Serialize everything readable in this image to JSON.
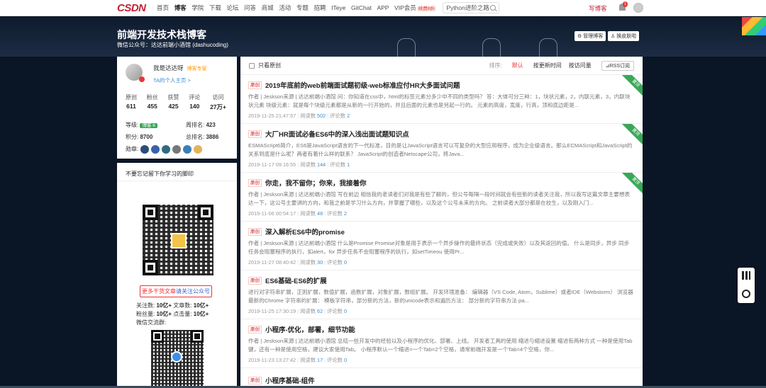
{
  "topbar": {
    "logo": "CSDN",
    "nav": [
      "首页",
      "博客",
      "学院",
      "下载",
      "论坛",
      "问答",
      "商城",
      "活动",
      "专题",
      "招聘",
      "ITeye",
      "GitChat",
      "APP"
    ],
    "vip": "VIP会员",
    "vip_badge": "续费8折",
    "search_value": "Python进阶之路",
    "write": "写博客",
    "bell_count": "1"
  },
  "banner": {
    "title": "前端开发技术栈博客",
    "subtitle": "微信公众号：达达前端小酒馆 (dashucoding)",
    "manage_btn": "管理博客",
    "skin_btn": "换皮肤啦"
  },
  "profile": {
    "name": "我是达达呀",
    "badge": "博客专家",
    "home_link": "TA的个人主页 >",
    "stats": [
      {
        "label": "原创",
        "value": "611"
      },
      {
        "label": "粉丝",
        "value": "455"
      },
      {
        "label": "获赞",
        "value": "425"
      },
      {
        "label": "评论",
        "value": "140"
      },
      {
        "label": "访问",
        "value": "27万+"
      }
    ],
    "level_label": "等级:",
    "level_badge": "博客 6",
    "week_rank_label": "周排名:",
    "week_rank": "423",
    "points_label": "积分:",
    "points": "8700",
    "total_rank_label": "总排名:",
    "total_rank": "3886",
    "medals_label": "勋章:"
  },
  "promo": {
    "heading": "不要忘记留下你学习的脚印",
    "follow_prefix": "更多干货文章",
    "follow_highlight": "请关注公众号",
    "l1": "关注数:",
    "v1": "10亿+",
    "l2": "文章数:",
    "v2": "10亿+",
    "l3": "粉丝量:",
    "v3": "10亿+",
    "l4": "点击量:",
    "v4": "10亿+",
    "group": "微信交流群:"
  },
  "toolbar": {
    "only_original": "只看原创",
    "sort_label": "排序:",
    "sort_default": "默认",
    "sort_time": "按更新时间",
    "sort_views": "按访问量",
    "rss": "RSS订阅"
  },
  "articles": [
    {
      "tag": "原创",
      "title": "2019年底前的web前端面试题初级-web标准应付HR大多面试问题",
      "summary": "作者 | Jeskson来源 | 达达前端小酒馆 问：你知道在css中，html的标签元素分多少中不同的类型吗？ 答：大体可分三种：1，块状元素，2，内联元素，3，内联块状元素 块级元素：就是每个块级元素都是从新的一行开始的，并且后面的元素也是另起一行的。 元素的高度，宽度，行高，顶和底边距是...",
      "date": "2019-11-25 21:47:57",
      "reads_label": "阅读数",
      "reads": "502",
      "comments_label": "评论数",
      "comments": "2",
      "pinned": "置顶"
    },
    {
      "tag": "原创",
      "title": "大厂HR面试必备ES6中的深入浅出面试题知识点",
      "summary": "ESMAScript6简介，ES6是JavaScript语言的下一代标准，目的是让JavaScript语言可以写复杂的大型应用程序，成为企业级语言。那么ECMAScript和JavaScript的关系到底是什么呢？两者有着什么样的联系？ JavaScript的创造者Netscape公司，将Java...",
      "date": "2019-11-17 09:16:55",
      "reads_label": "阅读数",
      "reads": "144",
      "comments_label": "评论数",
      "comments": "1",
      "pinned": "置顶"
    },
    {
      "tag": "原创",
      "title": "你走，我不留你；你来，我接着你",
      "summary": "作者 | Jeskson来源 | 达达前端小酒馆 写在前边 相信我的老读者们对我是有些了解的，但公号每隔一段时间就会有些新的读者关注我，所以我写这篇文章主要想表达一下，这公号主要讲的方向，和我之前是学习什么方向，并掌握了哪些，以及这个公号未来的方向。 之前读者大部分都是在校生，以及刚入门...",
      "date": "2019-11-06 00:54:17",
      "reads_label": "阅读数",
      "reads": "48",
      "comments_label": "评论数",
      "comments": "2",
      "pinned": "置顶"
    },
    {
      "tag": "原创",
      "title": "深入解析ES6中的promise",
      "summary": "作者 | Jeskson来源 | 达达前端小酒馆 什么是Promise Promise对象是用于表示一个异步操作的最终状态（完成或失败）以及其返回的值。 什么是同步，异步 同步任务会阻塞程序的执行，如alert，for 异步任务不会阻塞程序的执行，如setTimeou 使用Pr...",
      "date": "2019-11-27 08:40:42",
      "reads_label": "阅读数",
      "reads": "30",
      "comments_label": "评论数",
      "comments": "0",
      "pinned": ""
    },
    {
      "tag": "原创",
      "title": "ES6基础-ES6的扩展",
      "summary": "进行对字符串扩展，正则扩展，数值扩展，函数扩展，对象扩展，数组扩展。 开发环境准备： 编辑器（VS Code, Atom，Sublime）或者IDE（Webstorm） 浏览器最新的Chrome 字符串的扩展： 模板字符串，部分新的方法，新的unicode表示和遍历方法： 部分新的字符串方法 pa...",
      "date": "2019-11-25 17:30:19",
      "reads_label": "阅读数",
      "reads": "62",
      "comments_label": "评论数",
      "comments": "0",
      "pinned": ""
    },
    {
      "tag": "原创",
      "title": "小程序-优化，部署，细节功能",
      "summary": "作者 | Jeskson来源 | 达达前端小酒馆 总结一些开发中的经验以及小程序的优化、部署、上线。 开发者工具的使用 缩进与缩进设置 缩进有两种方式 一种是使用Tab键，还有一种是使用空格，建议大家使用Tab。 小程序默认一个缩进=一个Tab=2个空格，通常前端开发是一个Tab=4个空格，你...",
      "date": "2019-11-23 13:27:42",
      "reads_label": "阅读数",
      "reads": "17",
      "comments_label": "评论数",
      "comments": "0",
      "pinned": ""
    }
  ],
  "last_article": {
    "tag": "原创",
    "title": "小程序基础-组件"
  },
  "colors": {
    "brand": "#c32136",
    "accent_blue": "#3d8bd1",
    "pinned_green": "#3aa757"
  }
}
